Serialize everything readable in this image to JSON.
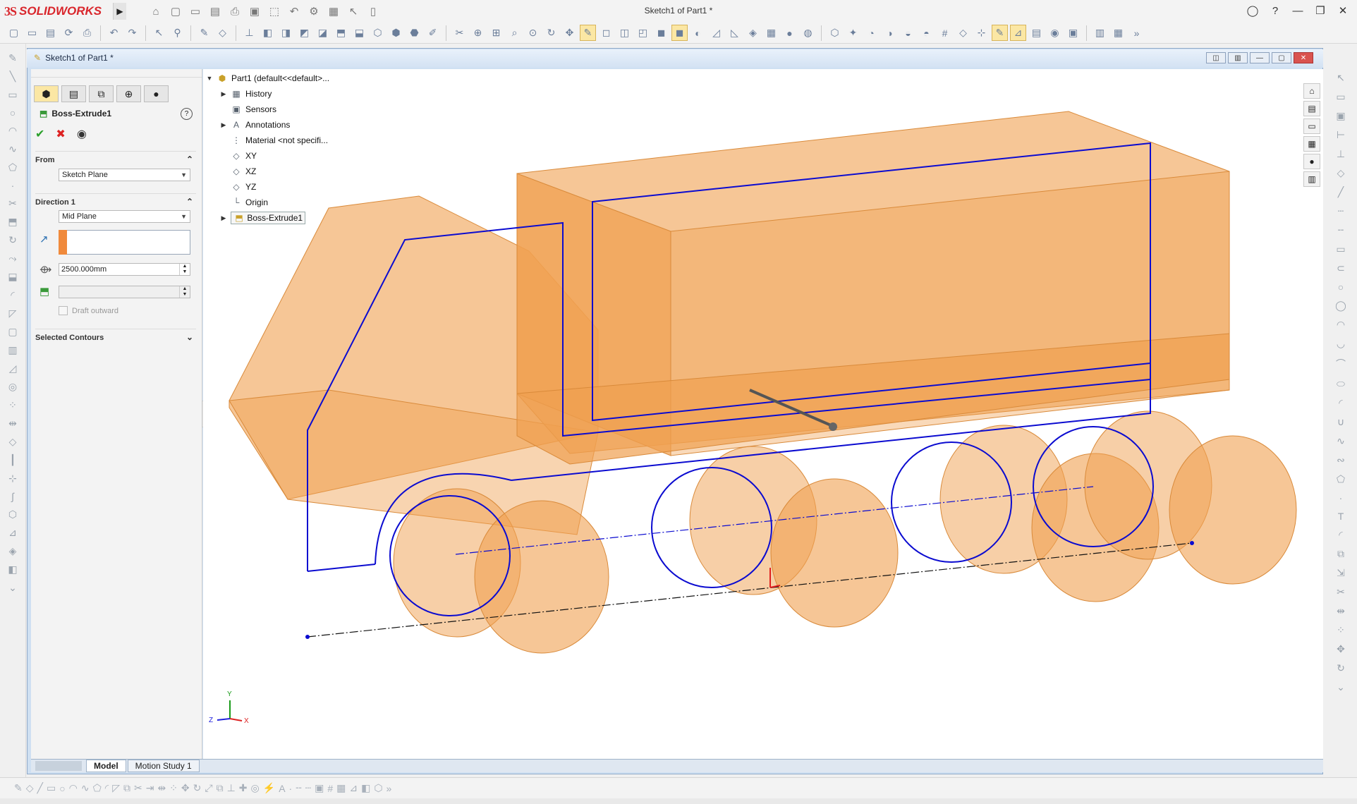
{
  "app": {
    "brand_prefix": "3S",
    "brand_name": "SOLIDWORKS",
    "document_title": "Sketch1 of Part1 *"
  },
  "doc_window": {
    "caption": "Sketch1 of Part1 *"
  },
  "property_manager": {
    "feature_title": "Boss-Extrude1",
    "help": "?",
    "from": {
      "label": "From",
      "value": "Sketch Plane"
    },
    "direction1": {
      "label": "Direction 1",
      "end_condition": "Mid Plane",
      "depth": "2500.000mm",
      "draft_label": "Draft outward"
    },
    "selected_contours": {
      "label": "Selected Contours"
    }
  },
  "tree": {
    "root": "Part1  (default<<default>...",
    "items": [
      "History",
      "Sensors",
      "Annotations",
      "Material <not specifi...",
      "XY",
      "XZ",
      "YZ",
      "Origin",
      "Boss-Extrude1"
    ]
  },
  "bottom_tabs": [
    "Model",
    "Motion Study 1"
  ],
  "triad": {
    "x": "X",
    "y": "Y",
    "z": "Z"
  },
  "colors": {
    "body": "#f0a050",
    "sketch": "#0b0bd0",
    "brand": "#d9262c"
  }
}
